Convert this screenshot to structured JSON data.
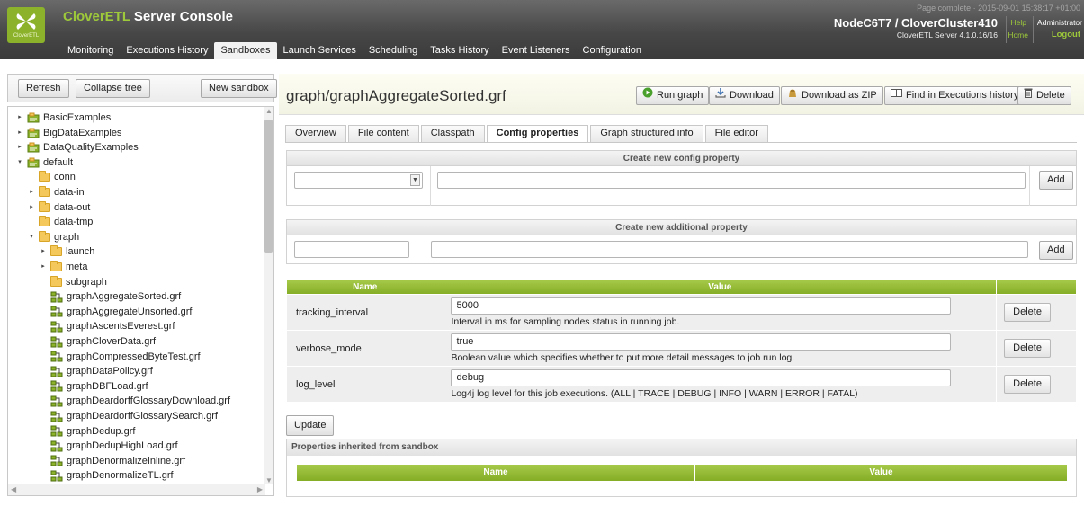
{
  "header": {
    "logo_text": "CloverETL",
    "app_title_prefix": "CloverETL",
    "app_title_suffix": "Server Console",
    "nav": [
      "Monitoring",
      "Executions History",
      "Sandboxes",
      "Launch Services",
      "Scheduling",
      "Tasks History",
      "Event Listeners",
      "Configuration"
    ],
    "active_nav": "Sandboxes",
    "status": "Page complete · 2015-09-01 15:38:17 +01:00",
    "node_name": "NodeC6T7 / CloverCluster410",
    "server_version": "CloverETL Server 4.1.0.16/16",
    "help": "Help",
    "home": "Home",
    "user": "Administrator",
    "logout": "Logout",
    "colors": {
      "brand_green": "#8bb22a",
      "header_bg": "#474747"
    }
  },
  "sidebar": {
    "refresh": "Refresh",
    "collapse": "Collapse tree",
    "new_sandbox": "New sandbox",
    "tree": [
      {
        "label": "BasicExamples",
        "type": "sandbox",
        "expander": "collapsed"
      },
      {
        "label": "BigDataExamples",
        "type": "sandbox",
        "expander": "collapsed"
      },
      {
        "label": "DataQualityExamples",
        "type": "sandbox",
        "expander": "collapsed"
      },
      {
        "label": "default",
        "type": "sandbox",
        "expander": "expanded"
      },
      {
        "label": "conn",
        "type": "folder",
        "expander": "none"
      },
      {
        "label": "data-in",
        "type": "folder",
        "expander": "collapsed"
      },
      {
        "label": "data-out",
        "type": "folder",
        "expander": "collapsed"
      },
      {
        "label": "data-tmp",
        "type": "folder",
        "expander": "none"
      },
      {
        "label": "graph",
        "type": "folder",
        "expander": "expanded"
      },
      {
        "label": "launch",
        "type": "folder",
        "expander": "collapsed"
      },
      {
        "label": "meta",
        "type": "folder",
        "expander": "collapsed"
      },
      {
        "label": "subgraph",
        "type": "folder",
        "expander": "none"
      },
      {
        "label": "graphAggregateSorted.grf",
        "type": "graph",
        "expander": "none"
      },
      {
        "label": "graphAggregateUnsorted.grf",
        "type": "graph",
        "expander": "none"
      },
      {
        "label": "graphAscentsEverest.grf",
        "type": "graph",
        "expander": "none"
      },
      {
        "label": "graphCloverData.grf",
        "type": "graph",
        "expander": "none"
      },
      {
        "label": "graphCompressedByteTest.grf",
        "type": "graph",
        "expander": "none"
      },
      {
        "label": "graphDataPolicy.grf",
        "type": "graph",
        "expander": "none"
      },
      {
        "label": "graphDBFLoad.grf",
        "type": "graph",
        "expander": "none"
      },
      {
        "label": "graphDeardorffGlossaryDownload.grf",
        "type": "graph",
        "expander": "none"
      },
      {
        "label": "graphDeardorffGlossarySearch.grf",
        "type": "graph",
        "expander": "none"
      },
      {
        "label": "graphDedup.grf",
        "type": "graph",
        "expander": "none"
      },
      {
        "label": "graphDedupHighLoad.grf",
        "type": "graph",
        "expander": "none"
      },
      {
        "label": "graphDenormalizeInline.grf",
        "type": "graph",
        "expander": "none"
      },
      {
        "label": "graphDenormalizeTL.grf",
        "type": "graph",
        "expander": "none"
      }
    ]
  },
  "main": {
    "title": "graph/graphAggregateSorted.grf",
    "actions": {
      "run": "Run graph",
      "download": "Download",
      "download_zip": "Download as ZIP",
      "find": "Find in Executions history",
      "delete": "Delete"
    },
    "tabs": [
      "Overview",
      "File content",
      "Classpath",
      "Config properties",
      "Graph structured info",
      "File editor"
    ],
    "active_tab": "Config properties",
    "config_section": {
      "title": "Create new config property",
      "select_value": "",
      "value": "",
      "add": "Add"
    },
    "additional_section": {
      "title": "Create new additional property",
      "name": "",
      "value": "",
      "add": "Add"
    },
    "props_table": {
      "headers": [
        "Name",
        "Value"
      ],
      "rows": [
        {
          "name": "tracking_interval",
          "value": "5000",
          "desc": "Interval in ms for sampling nodes status in running job.",
          "delete": "Delete"
        },
        {
          "name": "verbose_mode",
          "value": "true",
          "desc": "Boolean value which specifies whether to put more detail messages to job run log.",
          "delete": "Delete"
        },
        {
          "name": "log_level",
          "value": "debug",
          "desc": "Log4j log level for this job executions. (ALL | TRACE | DEBUG | INFO | WARN | ERROR | FATAL)",
          "delete": "Delete"
        }
      ]
    },
    "update": "Update",
    "inherited": {
      "title": "Properties inherited from sandbox",
      "headers": [
        "Name",
        "Value"
      ]
    }
  }
}
